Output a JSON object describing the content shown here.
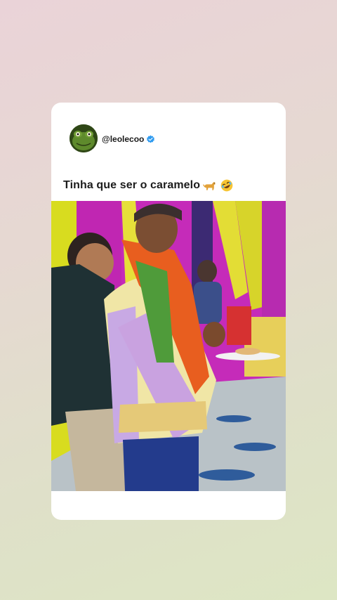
{
  "post": {
    "username": "@leolecoo",
    "verified": true,
    "caption": "Tinha que ser o caramelo",
    "caption_emojis": [
      "dog-emoji",
      "rofl-emoji"
    ]
  },
  "colors": {
    "background_top": "#ead3d8",
    "background_bottom": "#dde6c4",
    "card": "#ffffff",
    "verified_badge": "#2f9bf0"
  }
}
